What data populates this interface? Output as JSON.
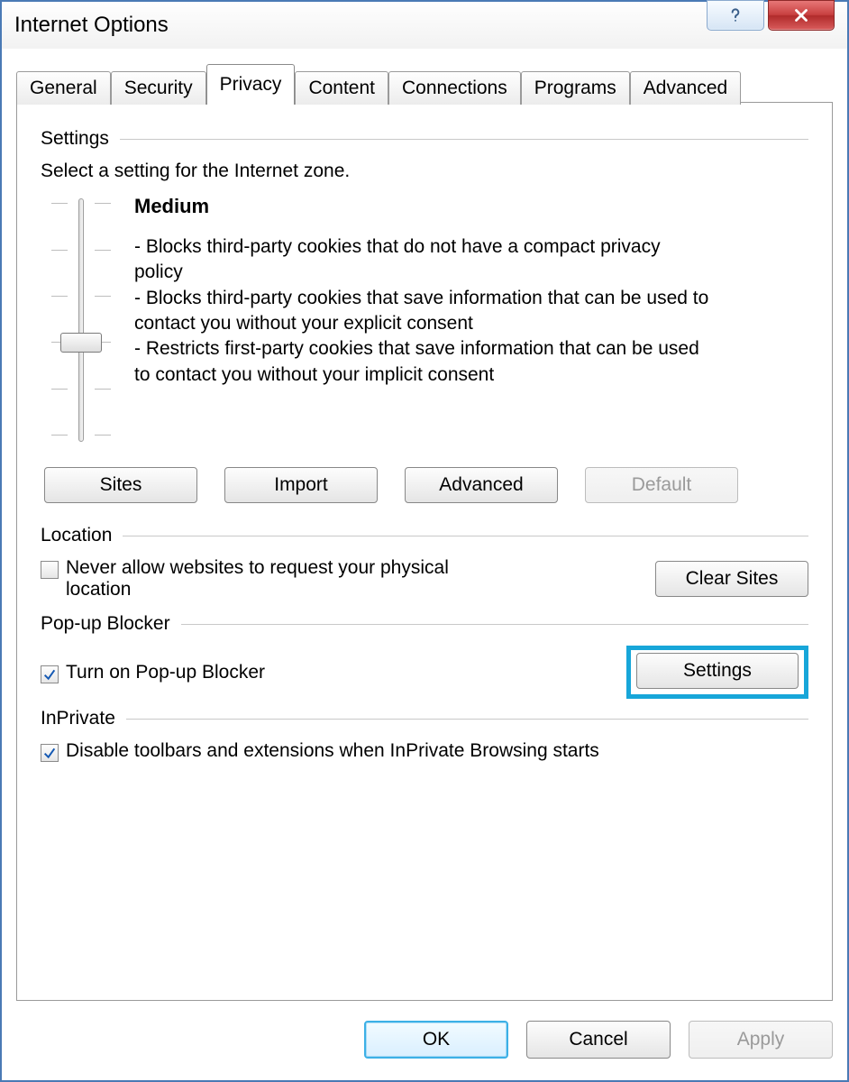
{
  "window": {
    "title": "Internet Options"
  },
  "tabs": {
    "general": "General",
    "security": "Security",
    "privacy": "Privacy",
    "content": "Content",
    "connections": "Connections",
    "programs": "Programs",
    "advanced": "Advanced",
    "active": "privacy"
  },
  "settings": {
    "group_title": "Settings",
    "instruction": "Select a setting for the Internet zone.",
    "level_name": "Medium",
    "desc1": "- Blocks third-party cookies that do not have a compact privacy policy",
    "desc2": "- Blocks third-party cookies that save information that can be used to contact you without your explicit consent",
    "desc3": "- Restricts first-party cookies that save information that can be used to contact you without your implicit consent",
    "buttons": {
      "sites": "Sites",
      "import": "Import",
      "advanced": "Advanced",
      "default": "Default"
    }
  },
  "location": {
    "group_title": "Location",
    "checkbox_label": "Never allow websites to request your physical location",
    "checked": false,
    "clear_sites": "Clear Sites"
  },
  "popup": {
    "group_title": "Pop-up Blocker",
    "checkbox_label": "Turn on Pop-up Blocker",
    "checked": true,
    "settings_button": "Settings"
  },
  "inprivate": {
    "group_title": "InPrivate",
    "checkbox_label": "Disable toolbars and extensions when InPrivate Browsing starts",
    "checked": true
  },
  "dialog_buttons": {
    "ok": "OK",
    "cancel": "Cancel",
    "apply": "Apply"
  }
}
